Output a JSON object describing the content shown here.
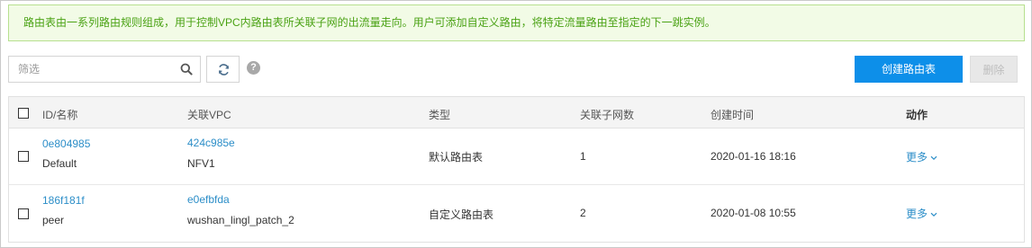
{
  "notice": "路由表由一系列路由规则组成，用于控制VPC内路由表所关联子网的出流量走向。用户可添加自定义路由，将特定流量路由至指定的下一跳实例。",
  "toolbar": {
    "search_placeholder": "筛选",
    "help_glyph": "?",
    "create_label": "创建路由表",
    "delete_label": "删除"
  },
  "table": {
    "headers": [
      "ID/名称",
      "关联VPC",
      "类型",
      "关联子网数",
      "创建时间",
      "动作"
    ],
    "rows": [
      {
        "id": "0e804985",
        "name": "Default",
        "vpc_id": "424c985e",
        "vpc_name": "NFV1",
        "type": "默认路由表",
        "subnets": "1",
        "created": "2020-01-16 18:16",
        "action": "更多"
      },
      {
        "id": "186f181f",
        "name": "peer",
        "vpc_id": "e0efbfda",
        "vpc_name": "wushan_lingl_patch_2",
        "type": "自定义路由表",
        "subnets": "2",
        "created": "2020-01-08 10:55",
        "action": "更多"
      }
    ]
  },
  "colors": {
    "notice_text": "#4aa214",
    "notice_bg": "#f2fbe6",
    "primary": "#0d8fe9",
    "link": "#2c8ec8"
  },
  "icons": [
    "search-icon",
    "refresh-icon",
    "help-icon",
    "chevron-down-icon"
  ]
}
